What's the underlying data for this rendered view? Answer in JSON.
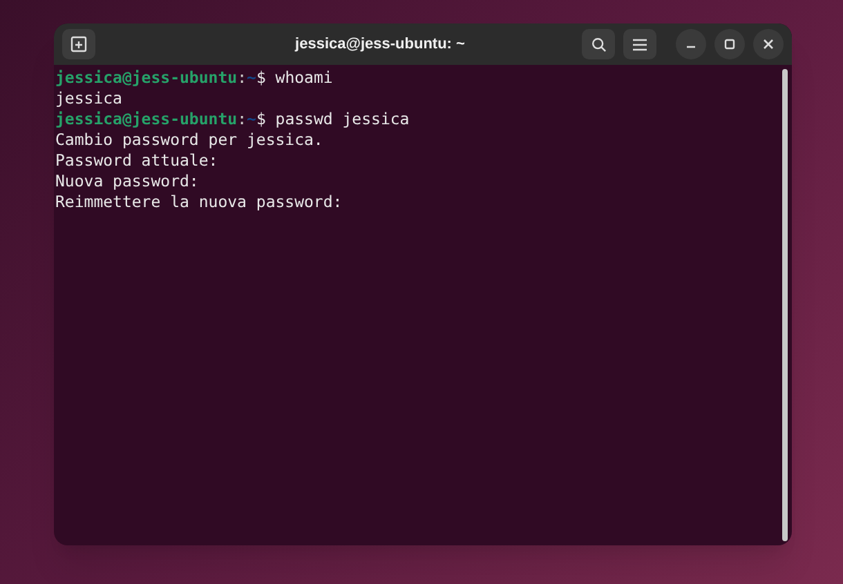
{
  "window": {
    "title": "jessica@jess-ubuntu: ~"
  },
  "terminal": {
    "lines": [
      {
        "kind": "prompt",
        "user_host": "jessica@jess-ubuntu",
        "separator": ":",
        "path": "~",
        "symbol": "$",
        "command": "whoami"
      },
      {
        "kind": "output",
        "text": "jessica"
      },
      {
        "kind": "prompt",
        "user_host": "jessica@jess-ubuntu",
        "separator": ":",
        "path": "~",
        "symbol": "$",
        "command": "passwd jessica"
      },
      {
        "kind": "output",
        "text": "Cambio password per jessica."
      },
      {
        "kind": "output",
        "text": "Password attuale:"
      },
      {
        "kind": "output",
        "text": "Nuova password:"
      },
      {
        "kind": "output",
        "text": "Reimmettere la nuova password:"
      }
    ]
  }
}
